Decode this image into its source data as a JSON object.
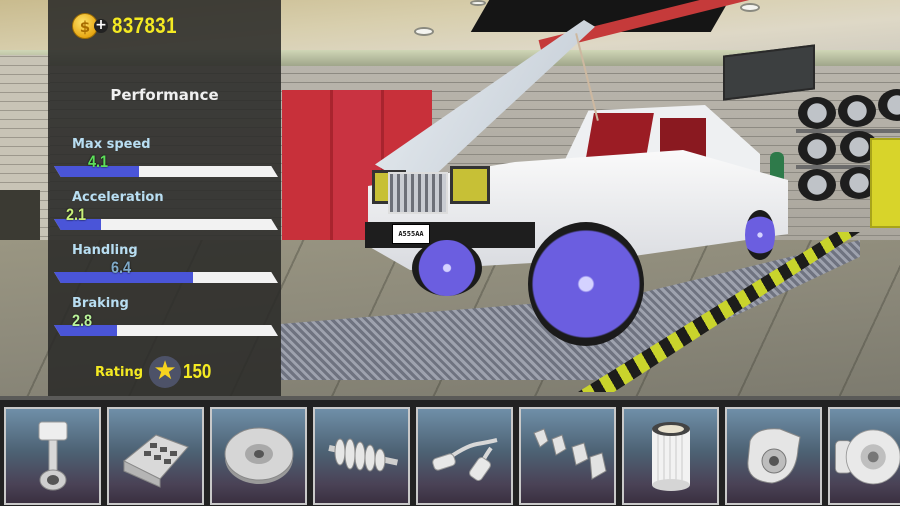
{
  "hud": {
    "money": {
      "icon": "dollar-coin-icon",
      "coin_symbol": "$",
      "add_symbol": "+",
      "value": "837831"
    }
  },
  "performance": {
    "title": "Performance",
    "scale_max": 10,
    "stats": [
      {
        "label": "Max speed",
        "value": "4.1",
        "fill_fraction": 0.38,
        "value_color": "#5de05a"
      },
      {
        "label": "Acceleration",
        "value": "2.1",
        "fill_fraction": 0.21,
        "value_color": "#c8f07a"
      },
      {
        "label": "Handling",
        "value": "6.4",
        "fill_fraction": 0.62,
        "value_color": "#7fa9c8"
      },
      {
        "label": "Braking",
        "value": "2.8",
        "fill_fraction": 0.28,
        "value_color": "#b9f29a"
      }
    ],
    "rating": {
      "label": "Rating",
      "icon": "star-icon",
      "value": "150"
    }
  },
  "car": {
    "plate": "A555AA"
  },
  "parts": [
    {
      "name": "piston",
      "icon": "piston-icon"
    },
    {
      "name": "engine-block",
      "icon": "engine-block-icon"
    },
    {
      "name": "flywheel",
      "icon": "flywheel-icon"
    },
    {
      "name": "gearbox",
      "icon": "gearbox-icon"
    },
    {
      "name": "exhaust",
      "icon": "exhaust-icon"
    },
    {
      "name": "spark-plugs",
      "icon": "spark-plug-icon"
    },
    {
      "name": "air-filter",
      "icon": "air-filter-icon"
    },
    {
      "name": "turbocharger",
      "icon": "turbo-icon"
    },
    {
      "name": "brakes",
      "icon": "brake-disc-icon"
    }
  ],
  "colors": {
    "money_yellow": "#f4ea22",
    "bar_fill": "#4a55d8",
    "bar_track": "#f2f2f2",
    "label_blue": "#b8def2",
    "wheel_purple": "#6b5ee0",
    "hazard_yellow": "#c9d42c"
  }
}
